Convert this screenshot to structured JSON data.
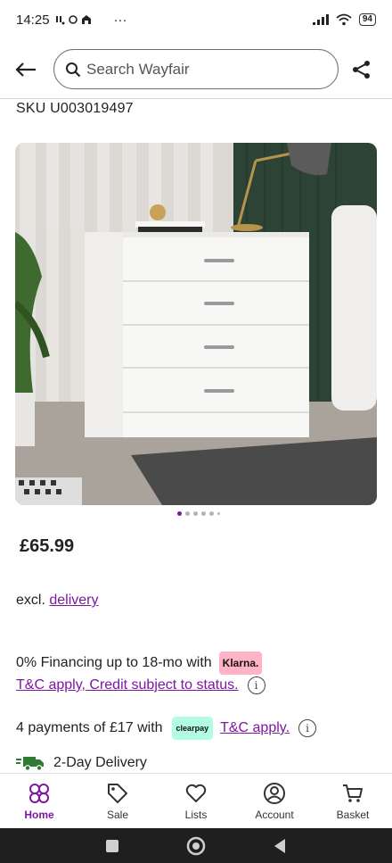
{
  "status_bar": {
    "time": "14:25",
    "indicators": "·:·",
    "more": "···",
    "battery": "94"
  },
  "search": {
    "placeholder": "Search Wayfair"
  },
  "product": {
    "sku": "SKU U003019497",
    "price": "£65.99",
    "excl_prefix": "excl.",
    "delivery_link": "delivery",
    "financing_text": "0% Financing up to 18-mo with",
    "klarna_badge": "Klarna.",
    "tc_credit_link": "T&C apply, Credit subject to status.",
    "payments_text": "4 payments of £17 with",
    "clearpay_badge": "clearpay",
    "tc_apply_link": "T&C apply.",
    "delivery_text": "2-Day Delivery",
    "image_dots": {
      "count": 6,
      "active_index": 0
    }
  },
  "bottom_nav": {
    "items": [
      {
        "label": "Home",
        "icon": "home-icon"
      },
      {
        "label": "Sale",
        "icon": "tag-icon"
      },
      {
        "label": "Lists",
        "icon": "heart-icon"
      },
      {
        "label": "Account",
        "icon": "account-icon"
      },
      {
        "label": "Basket",
        "icon": "cart-icon"
      }
    ]
  },
  "colors": {
    "brand_purple": "#7b189f",
    "klarna_pink": "#ffb3c7",
    "clearpay_mint": "#b2fce4"
  }
}
